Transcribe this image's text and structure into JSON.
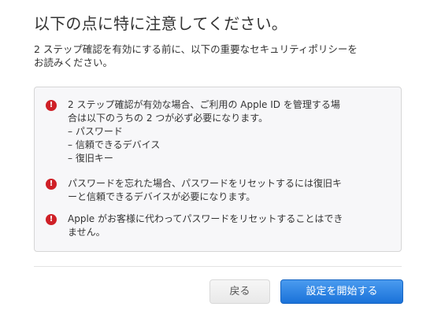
{
  "dialog": {
    "title": "以下の点に特に注意してください。",
    "intro_lines": [
      "2 ステップ確認を有効にする前に、以下の重要なセキュリティポリシーを",
      "お読みください。"
    ]
  },
  "warnings": {
    "icon": "exclamation-circle-icon",
    "icon_glyph": "!",
    "icon_color": "#cf2027",
    "items": [
      {
        "lines": [
          "2 ステップ確認が有効な場合、ご利用の Apple ID を管理する場",
          "合は以下のうちの 2 つが必ず必要になります。"
        ],
        "sublist": [
          "– パスワード",
          "– 信頼できるデバイス",
          "– 復旧キー"
        ]
      },
      {
        "lines": [
          "パスワードを忘れた場合、パスワードをリセットするには復旧キ",
          "ーと信頼できるデバイスが必要になります。"
        ]
      },
      {
        "lines": [
          "Apple がお客様に代わってパスワードをリセットすることはでき",
          "ません。"
        ]
      }
    ]
  },
  "buttons": {
    "back_label": "戻る",
    "start_label": "設定を開始する",
    "start_color": "#2a84e6"
  }
}
